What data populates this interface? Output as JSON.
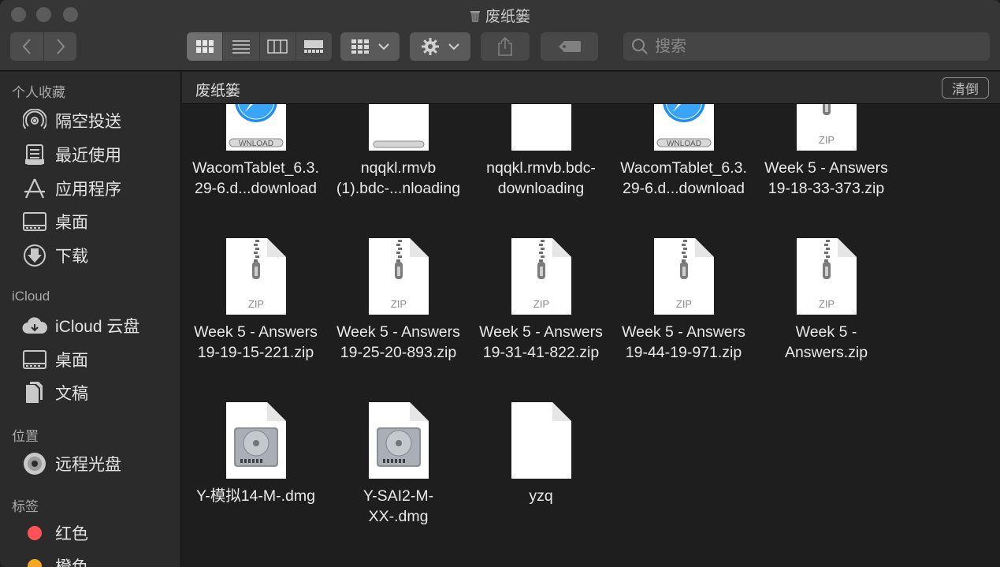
{
  "window": {
    "title": "废纸篓"
  },
  "toolbar": {
    "search_placeholder": "搜索"
  },
  "sidebar": {
    "sections": [
      {
        "title": "个人收藏"
      },
      {
        "title": "iCloud"
      },
      {
        "title": "位置"
      },
      {
        "title": "标签"
      }
    ],
    "favorites": [
      {
        "label": "隔空投送",
        "icon": "airdrop-icon"
      },
      {
        "label": "最近使用",
        "icon": "recents-icon"
      },
      {
        "label": "应用程序",
        "icon": "applications-icon"
      },
      {
        "label": "桌面",
        "icon": "desktop-icon"
      },
      {
        "label": "下载",
        "icon": "downloads-icon"
      }
    ],
    "icloud": [
      {
        "label": "iCloud 云盘",
        "icon": "icloud-drive-icon"
      },
      {
        "label": "桌面",
        "icon": "desktop-icon"
      },
      {
        "label": "文稿",
        "icon": "documents-icon"
      }
    ],
    "locations": [
      {
        "label": "远程光盘",
        "icon": "remote-disc-icon"
      }
    ],
    "tags": [
      {
        "label": "红色",
        "color": "#ff5257"
      },
      {
        "label": "橙色",
        "color": "#f5a623"
      }
    ]
  },
  "pathbar": {
    "title": "废纸篓",
    "empty_button": "清倒"
  },
  "files": [
    {
      "name": "WacomTablet_6.3.\n29-6.d...download",
      "type": "safari-download",
      "badge": "WNLOAD"
    },
    {
      "name": "nqqkl.rmvb\n(1).bdc-...nloading",
      "type": "progress"
    },
    {
      "name": "nqqkl.rmvb.bdc-\ndownloading",
      "type": "blank"
    },
    {
      "name": "WacomTablet_6.3.\n29-6.d...download",
      "type": "safari-download",
      "badge": "WNLOAD"
    },
    {
      "name": "Week 5 - Answers\n19-18-33-373.zip",
      "type": "zip",
      "badge": "ZIP"
    },
    {
      "name": "Week 5 - Answers\n19-19-15-221.zip",
      "type": "zip",
      "badge": "ZIP"
    },
    {
      "name": "Week 5 - Answers\n19-25-20-893.zip",
      "type": "zip",
      "badge": "ZIP"
    },
    {
      "name": "Week 5 - Answers\n19-31-41-822.zip",
      "type": "zip",
      "badge": "ZIP"
    },
    {
      "name": "Week 5 - Answers\n19-44-19-971.zip",
      "type": "zip",
      "badge": "ZIP"
    },
    {
      "name": "Week 5 -\nAnswers.zip",
      "type": "zip",
      "badge": "ZIP"
    },
    {
      "name": "Y-模拟14-M-.dmg",
      "type": "dmg"
    },
    {
      "name": "Y-SAI2-M-\nXX-.dmg",
      "type": "dmg"
    },
    {
      "name": "yzq",
      "type": "blank"
    }
  ]
}
